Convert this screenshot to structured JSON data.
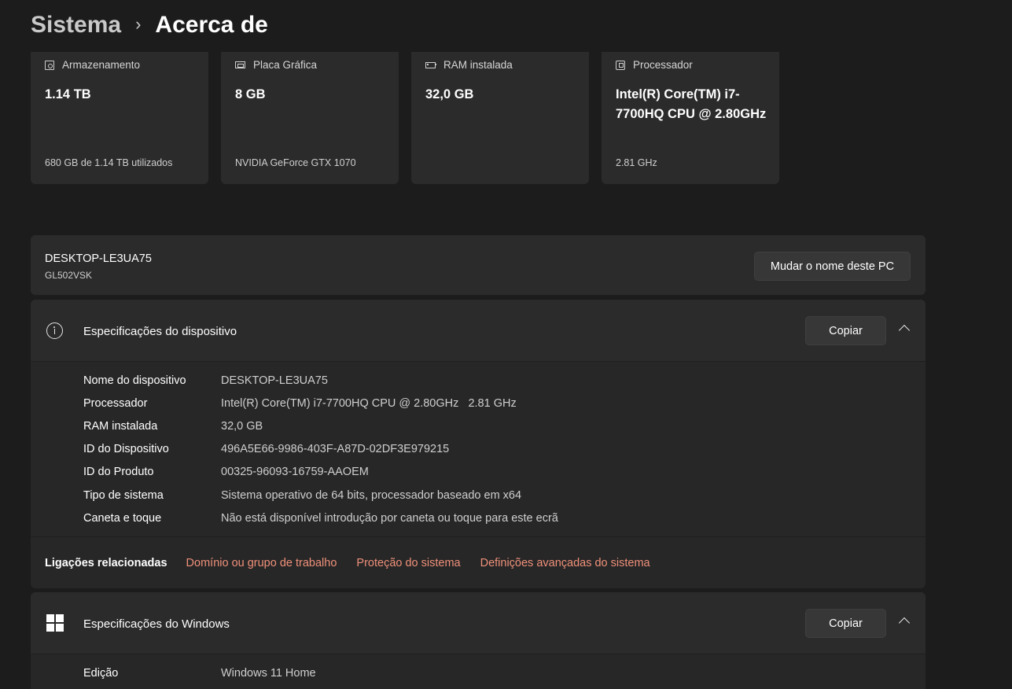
{
  "breadcrumb": {
    "parent": "Sistema",
    "separator": "›",
    "current": "Acerca de"
  },
  "cards": [
    {
      "icon": "storage-icon",
      "title": "Armazenamento",
      "value": "1.14 TB",
      "sub": "680 GB de 1.14 TB utilizados"
    },
    {
      "icon": "gpu-icon",
      "title": "Placa Gráfica",
      "value": "8 GB",
      "sub": "NVIDIA GeForce GTX 1070"
    },
    {
      "icon": "ram-icon",
      "title": "RAM instalada",
      "value": "32,0 GB",
      "sub": ""
    },
    {
      "icon": "cpu-icon",
      "title": "Processador",
      "value": "Intel(R) Core(TM) i7-7700HQ CPU @ 2.80GHz",
      "sub": "2.81 GHz"
    }
  ],
  "pc": {
    "name": "DESKTOP-LE3UA75",
    "model": "GL502VSK",
    "rename_label": "Mudar o nome deste PC"
  },
  "device_specs": {
    "icon": "info-icon",
    "title": "Especificações do dispositivo",
    "copy_label": "Copiar",
    "rows": [
      {
        "label": "Nome do dispositivo",
        "value": "DESKTOP-LE3UA75"
      },
      {
        "label": "Processador",
        "value": "Intel(R) Core(TM) i7-7700HQ CPU @ 2.80GHz   2.81 GHz"
      },
      {
        "label": "RAM instalada",
        "value": "32,0 GB"
      },
      {
        "label": "ID do Dispositivo",
        "value": "496A5E66-9986-403F-A87D-02DF3E979215"
      },
      {
        "label": "ID do Produto",
        "value": "00325-96093-16759-AAOEM"
      },
      {
        "label": "Tipo de sistema",
        "value": "Sistema operativo de 64 bits, processador baseado em x64"
      },
      {
        "label": "Caneta e toque",
        "value": "Não está disponível introdução por caneta ou toque para este ecrã"
      }
    ]
  },
  "related": {
    "label": "Ligações relacionadas",
    "links": [
      "Domínio ou grupo de trabalho",
      "Proteção do sistema",
      "Definições avançadas do sistema"
    ]
  },
  "windows_specs": {
    "icon": "windows-logo-icon",
    "title": "Especificações do Windows",
    "copy_label": "Copiar",
    "rows": [
      {
        "label": "Edição",
        "value": "Windows 11 Home"
      }
    ]
  },
  "colors": {
    "background": "#1c1c1c",
    "card": "#2b2b2b",
    "link_accent": "#f0917a"
  }
}
